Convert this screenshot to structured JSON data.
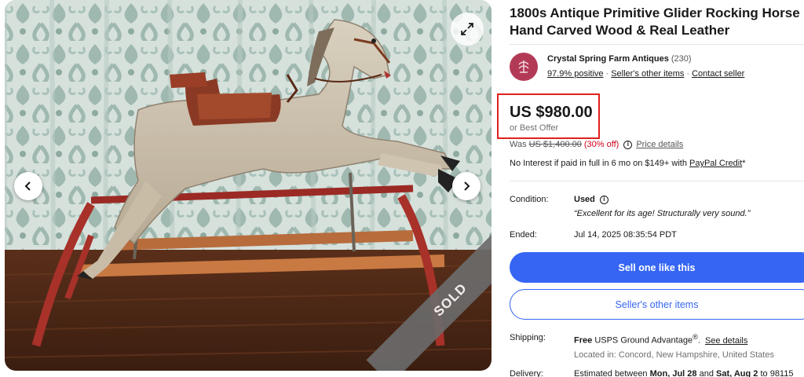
{
  "title_line1": "1800s Antique Primitive Glider Rocking Horse",
  "title_line2": "Hand Carved Wood & Real Leather",
  "gallery": {
    "sold_label": "SOLD",
    "photo_alt": "Antique glider rocking horse photo",
    "icons": {
      "prev": "chevron-left-icon",
      "next": "chevron-right-icon",
      "expand": "expand-icon"
    }
  },
  "seller": {
    "name": "Crystal Spring Farm Antiques",
    "feedback_count": "(230)",
    "positive": "97.9% positive",
    "other_items_link": "Seller's other items",
    "contact_link": "Contact seller",
    "separator": "·"
  },
  "price": {
    "current": "US $980.00",
    "best_offer": "or Best Offer",
    "was_label": "Was",
    "was_value": "US $1,400.00",
    "discount": "(30% off)",
    "details_link": "Price details"
  },
  "financing": {
    "text": "No Interest if paid in full in 6 mo on $149+ with",
    "link": "PayPal Credit",
    "suffix": "*"
  },
  "condition": {
    "label": "Condition:",
    "value": "Used",
    "quote": "“Excellent for its age! Structurally very sound.”"
  },
  "ended": {
    "label": "Ended:",
    "value": "Jul 14, 2025 08:35:54 PDT"
  },
  "buttons": {
    "sell_one": "Sell one like this",
    "seller_items": "Seller's other items"
  },
  "shipping": {
    "label": "Shipping:",
    "free": "Free",
    "service": "USPS Ground Advantage",
    "reg": "®",
    "link": "See details",
    "location": "Located in: Concord, New Hampshire, United States"
  },
  "delivery": {
    "label": "Delivery:",
    "text": "Estimated between",
    "date1": "Mon, Jul 28",
    "and": "and",
    "date2": "Sat, Aug 2",
    "to": "to 98115"
  },
  "colors": {
    "accent_blue": "#3665f3",
    "discount_red": "#d0021b",
    "highlight_red": "#e0201c",
    "seller_logo": "#b33a57"
  }
}
